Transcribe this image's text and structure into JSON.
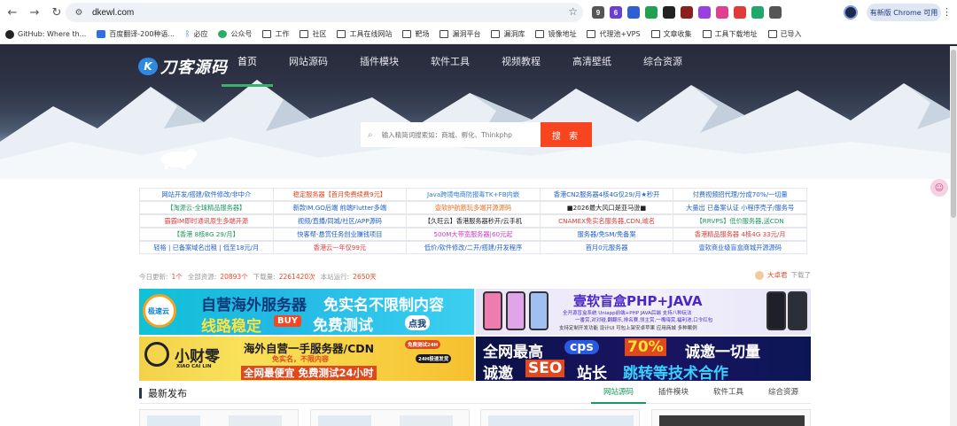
{
  "browser": {
    "url": "dkewl.com",
    "update_button": "有新版 Chrome 可用",
    "extensions": [
      {
        "label": "9",
        "color": "#555555"
      },
      {
        "label": "6",
        "color": "#6b3fd0"
      },
      {
        "label": "",
        "color": "#2f5fd0"
      },
      {
        "label": "",
        "color": "#20a050"
      },
      {
        "label": "",
        "color": "#222222"
      },
      {
        "label": "",
        "color": "#8a1f1f"
      },
      {
        "label": "",
        "color": "#9a3fe0"
      },
      {
        "label": "",
        "color": "#e04090"
      },
      {
        "label": "",
        "color": "#e03a3a"
      },
      {
        "label": "",
        "color": "#20a86a"
      },
      {
        "label": "",
        "color": "#555555"
      }
    ]
  },
  "bookmarks": [
    {
      "label": "GitHub: Where th...",
      "icon": "github-icon"
    },
    {
      "label": "百度翻译-200种语...",
      "icon": "baidu-icon"
    },
    {
      "label": "必应",
      "icon": "bing-icon"
    },
    {
      "label": "公众号",
      "icon": "wechat-icon"
    },
    {
      "label": "工作",
      "icon": "folder-icon"
    },
    {
      "label": "社区",
      "icon": "folder-icon"
    },
    {
      "label": "工具在线网站",
      "icon": "folder-icon"
    },
    {
      "label": "靶场",
      "icon": "folder-icon"
    },
    {
      "label": "漏洞平台",
      "icon": "folder-icon"
    },
    {
      "label": "漏洞库",
      "icon": "folder-icon"
    },
    {
      "label": "镜像地址",
      "icon": "folder-icon"
    },
    {
      "label": "代理池+VPS",
      "icon": "folder-icon"
    },
    {
      "label": "文章收集",
      "icon": "folder-icon"
    },
    {
      "label": "工具下载地址",
      "icon": "folder-icon"
    },
    {
      "label": "已导入",
      "icon": "folder-icon"
    }
  ],
  "site": {
    "logo_text": "刀客源码",
    "logo_mark": "K",
    "nav": [
      "首页",
      "网站源码",
      "插件模块",
      "软件工具",
      "视频教程",
      "高清壁纸",
      "综合资源"
    ],
    "search_placeholder": "输入精简词搜索如：商城、孵化、Thinkphp",
    "search_button": "搜 索"
  },
  "link_grid": [
    [
      {
        "text": "网站开发/搭建/软件修改/非中介",
        "color": "#1e5fd0"
      },
      {
        "text": "稳定服务器【首月免费续费9元】",
        "color": "#e0481f"
      },
      {
        "text": "Java跨境电商防报毒TK+FB内嵌",
        "color": "#2b7be0"
      },
      {
        "text": "香港CN2服务器4核4G仅29/月★秒开",
        "color": "#1e5fd0"
      },
      {
        "text": "付费视频招代理/分成70%/一切量",
        "color": "#1e5fd0"
      }
    ],
    [
      {
        "text": "【淘源云-全球精品服务器】",
        "color": "#1a9a5a"
      },
      {
        "text": "新款IM.GO后端 前端Flutter多端",
        "color": "#1e5fd0"
      },
      {
        "text": "壹软护航筋玩多端开源源码",
        "color": "#f06a1c"
      },
      {
        "text": "■2026最大风口是亚马逊■",
        "color": "#222222"
      },
      {
        "text": "大量出 已备案认证 小程序壳子/服务号",
        "color": "#1e5fd0"
      }
    ],
    [
      {
        "text": "霸霸IM即时通讯原生多端开源",
        "color": "#e03a3a"
      },
      {
        "text": "视频/直播/同城/社区/APP源码",
        "color": "#1e5fd0"
      },
      {
        "text": "【久旺云】香港服务器秒开/云手机",
        "color": "#222222"
      },
      {
        "text": "CNAMEX免实名服务器,CDN,域名",
        "color": "#e03a3a"
      },
      {
        "text": "【RRVPS】低价服务器,送CDN",
        "color": "#1a9a5a"
      }
    ],
    [
      {
        "text": "【香港 8核8G 29/月】",
        "color": "#1a9a5a"
      },
      {
        "text": "快客帮-悬赏任务创业赚钱项目",
        "color": "#1e5fd0"
      },
      {
        "text": "500M大带宽服务器|60元起",
        "color": "#d03ad0"
      },
      {
        "text": "服务器/免SM/免备案",
        "color": "#1e5fd0"
      },
      {
        "text": "香港精品服务器 4核4G 33元/月",
        "color": "#e03a3a"
      }
    ],
    [
      {
        "text": "轻格 | 已备案域名出租 | 低至18元/月",
        "color": "#1e5fd0"
      },
      {
        "text": "香港云一年仅99元",
        "color": "#e03a3a"
      },
      {
        "text": "低价/软件修改/二开/搭建/开发程序",
        "color": "#1e5fd0"
      },
      {
        "text": "首月0元服务器",
        "color": "#1e5fd0"
      },
      {
        "text": "壹软商业级盲盒商城开源源码",
        "color": "#1e5fd0"
      }
    ]
  ],
  "stats": {
    "today_label": "今日更新:",
    "today_value": "1个",
    "total_label": "全部资源:",
    "total_value": "20893个",
    "download_label": "下载量:",
    "download_value": "2261420次",
    "site_label": "本站运行:",
    "site_value": "2650天",
    "app_name": "大卓君",
    "app_suffix": "下载了"
  },
  "banners": {
    "b1": {
      "brand": "极速云",
      "line1": "自营海外服务器",
      "line1b": "免实名不限制内容",
      "line2": "线路稳定",
      "buy": "BUY",
      "free": "免费测试",
      "click": "点我"
    },
    "b2": {
      "title": "壹软盲盒PHP+JAVA",
      "sub1": "全开源盲盒系统 Uniapp前端+PHP JAVA后端 支持八种玩法",
      "sub2": "一番赏,对对碰,翻翻乐,排名赛,领主赏,一嘴嗨赏,福利池,口令红包",
      "sub3": "支持定制开发功能 设计UI 可包上架安卓苹果 应用商城 多种案例"
    },
    "b3": {
      "brand": "小财零",
      "brand_en": "XIAO CAI LIN",
      "line1": "海外自营一手服务器/CDN",
      "tag1": "免费测试24H",
      "line2": "免实名，不限内容",
      "line3": "全网最便宜 免费测试24小时",
      "tag2": "24H极速发货"
    },
    "b4": {
      "w1": "全网最高",
      "cps": "cps",
      "pct": "70%",
      "w2": "诚邀一切量",
      "w3": "诚邀",
      "seo": "SEO",
      "w4": "站长",
      "w5": "跳转等技术合作"
    }
  },
  "latest": {
    "title": "最新发布",
    "tabs": [
      "网站源码",
      "插件模块",
      "软件工具",
      "综合资源"
    ]
  }
}
